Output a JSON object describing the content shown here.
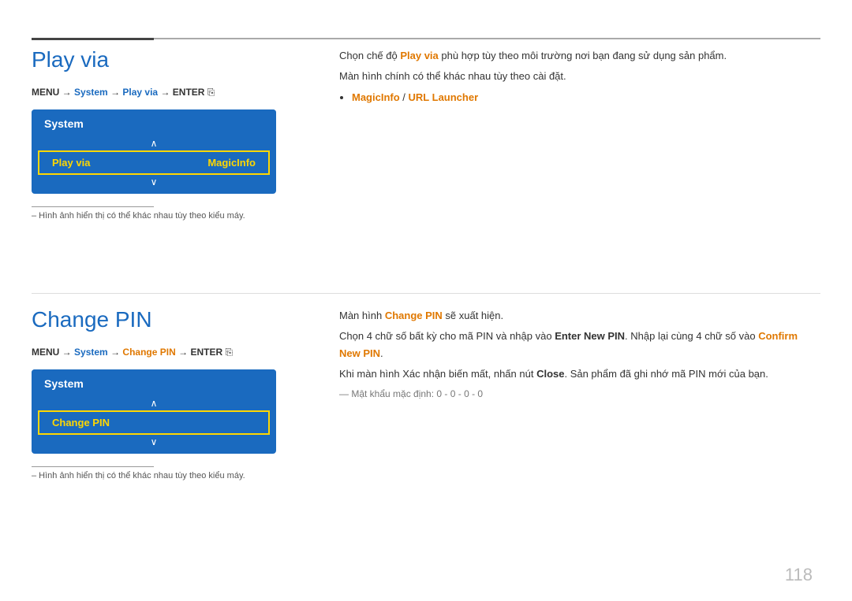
{
  "page": {
    "page_number": "118"
  },
  "top_line": {},
  "section1": {
    "title": "Play via",
    "menu_path_parts": [
      {
        "text": "MENU ",
        "style": "bold"
      },
      {
        "text": "→ ",
        "style": "normal"
      },
      {
        "text": "System",
        "style": "blue"
      },
      {
        "text": " → ",
        "style": "normal"
      },
      {
        "text": "Play via",
        "style": "blue"
      },
      {
        "text": " → ",
        "style": "normal"
      },
      {
        "text": "ENTER",
        "style": "bold"
      }
    ],
    "system_box": {
      "header": "System",
      "arrow_up": "∧",
      "item_label": "Play via",
      "item_value": "MagicInfo",
      "arrow_down": "∨"
    },
    "image_note_line": "",
    "image_note": "– Hình ảnh hiển thị có thể khác nhau tùy theo kiểu máy.",
    "right_text1": "Chọn chế độ Play via phù hợp tùy theo môi trường nơi bạn đang sử dụng sản phẩm.",
    "right_text2": "Màn hình chính có thể khác nhau tùy theo cài đặt.",
    "bullet_item": "MagicInfo / URL Launcher"
  },
  "section2": {
    "title": "Change PIN",
    "menu_path_parts": [
      {
        "text": "MENU ",
        "style": "bold"
      },
      {
        "text": "→ ",
        "style": "normal"
      },
      {
        "text": "System",
        "style": "blue"
      },
      {
        "text": " → ",
        "style": "normal"
      },
      {
        "text": "Change PIN",
        "style": "orange"
      },
      {
        "text": " → ",
        "style": "normal"
      },
      {
        "text": "ENTER",
        "style": "bold"
      }
    ],
    "system_box": {
      "header": "System",
      "arrow_up": "∧",
      "item_label": "Change PIN",
      "arrow_down": "∨"
    },
    "image_note_line": "",
    "image_note": "– Hình ảnh hiển thị có thể khác nhau tùy theo kiểu máy.",
    "right_text1": "Màn hình Change PIN sẽ xuất hiện.",
    "right_text2": "Chọn 4 chữ số bất kỳ cho mã PIN và nhập vào Enter New PIN. Nhập lại cùng 4 chữ số vào Confirm New PIN.",
    "right_text3": "Khi màn hình Xác nhận biến mất, nhấn nút Close. Sản phẩm đã ghi nhớ mã PIN mới của bạn.",
    "default_pwd_note": "— Mật khẩu mặc định: 0 - 0 - 0 - 0",
    "change_pin_label": "Change PIN",
    "enter_new_pin_label": "Enter New PIN",
    "confirm_new_pin_label": "Confirm New PIN",
    "close_label": "Close"
  },
  "colors": {
    "blue": "#1a6abf",
    "orange": "#e07800",
    "gold": "#ffd700"
  }
}
